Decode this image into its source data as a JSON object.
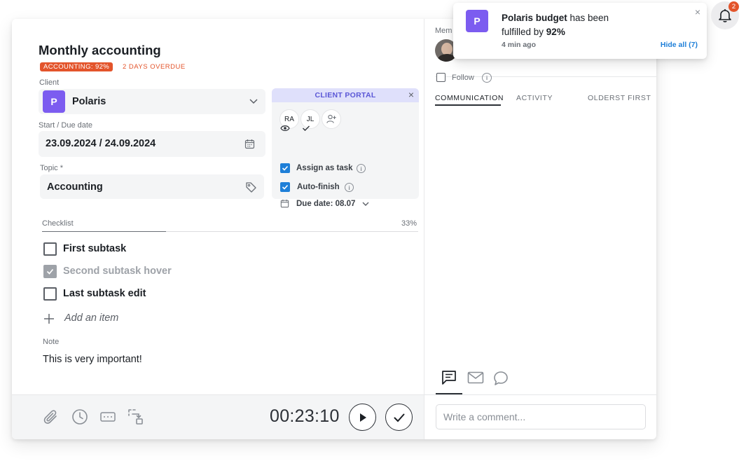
{
  "task": {
    "title": "Monthly accounting",
    "budget_badge": "ACCOUNTING: 92%",
    "overdue_badge": "2 DAYS OVERDUE"
  },
  "client": {
    "label": "Client",
    "avatar_letter": "P",
    "name": "Polaris"
  },
  "dates": {
    "label": "Start / Due date",
    "value": "23.09.2024 / 24.09.2024"
  },
  "topic": {
    "label": "Topic *",
    "value": "Accounting"
  },
  "portal": {
    "title": "CLIENT PORTAL",
    "members": [
      "RA",
      "JL"
    ],
    "assign_label": "Assign as task",
    "autofinish_label": "Auto-finish",
    "due_label": "Due date: 08.07"
  },
  "checklist": {
    "label": "Checklist",
    "percent_text": "33%",
    "progress": 0.33,
    "items": [
      {
        "text": "First subtask",
        "checked": false
      },
      {
        "text": "Second subtask hover",
        "checked": true
      },
      {
        "text": "Last subtask edit",
        "checked": false
      }
    ],
    "add_item": "Add an item"
  },
  "note": {
    "label": "Note",
    "text": "This is very important!"
  },
  "footer": {
    "timer": "00:23:10"
  },
  "right": {
    "members_label": "Mem",
    "follow_label": "Follow",
    "tabs": [
      "COMMUNICATION",
      "ACTIVITY"
    ],
    "sort_label": "OLDERST FIRST",
    "comment_placeholder": "Write a comment..."
  },
  "notification": {
    "avatar_letter": "P",
    "subject": "Polaris budget",
    "text_mid": " has been",
    "text_line2": "fulfilled by ",
    "percent": "92%",
    "time": "4 min ago",
    "hide_all": "Hide all (7)",
    "bell_count": "2"
  },
  "colors": {
    "accent_purple": "#7c5cf0",
    "overdue_orange": "#e3542b",
    "checkbox_blue": "#1e7fd8",
    "portal_header": "#dfe0fb"
  },
  "icons": [
    "chevron-down-icon",
    "calendar-icon",
    "tag-icon",
    "eye-icon",
    "check-icon",
    "add-user-icon",
    "info-icon",
    "plus-icon",
    "paperclip-icon",
    "clock-icon",
    "card-icon",
    "move-icon",
    "play-icon",
    "bell-icon",
    "close-icon",
    "chat-icon",
    "mail-icon",
    "comment-icon"
  ]
}
